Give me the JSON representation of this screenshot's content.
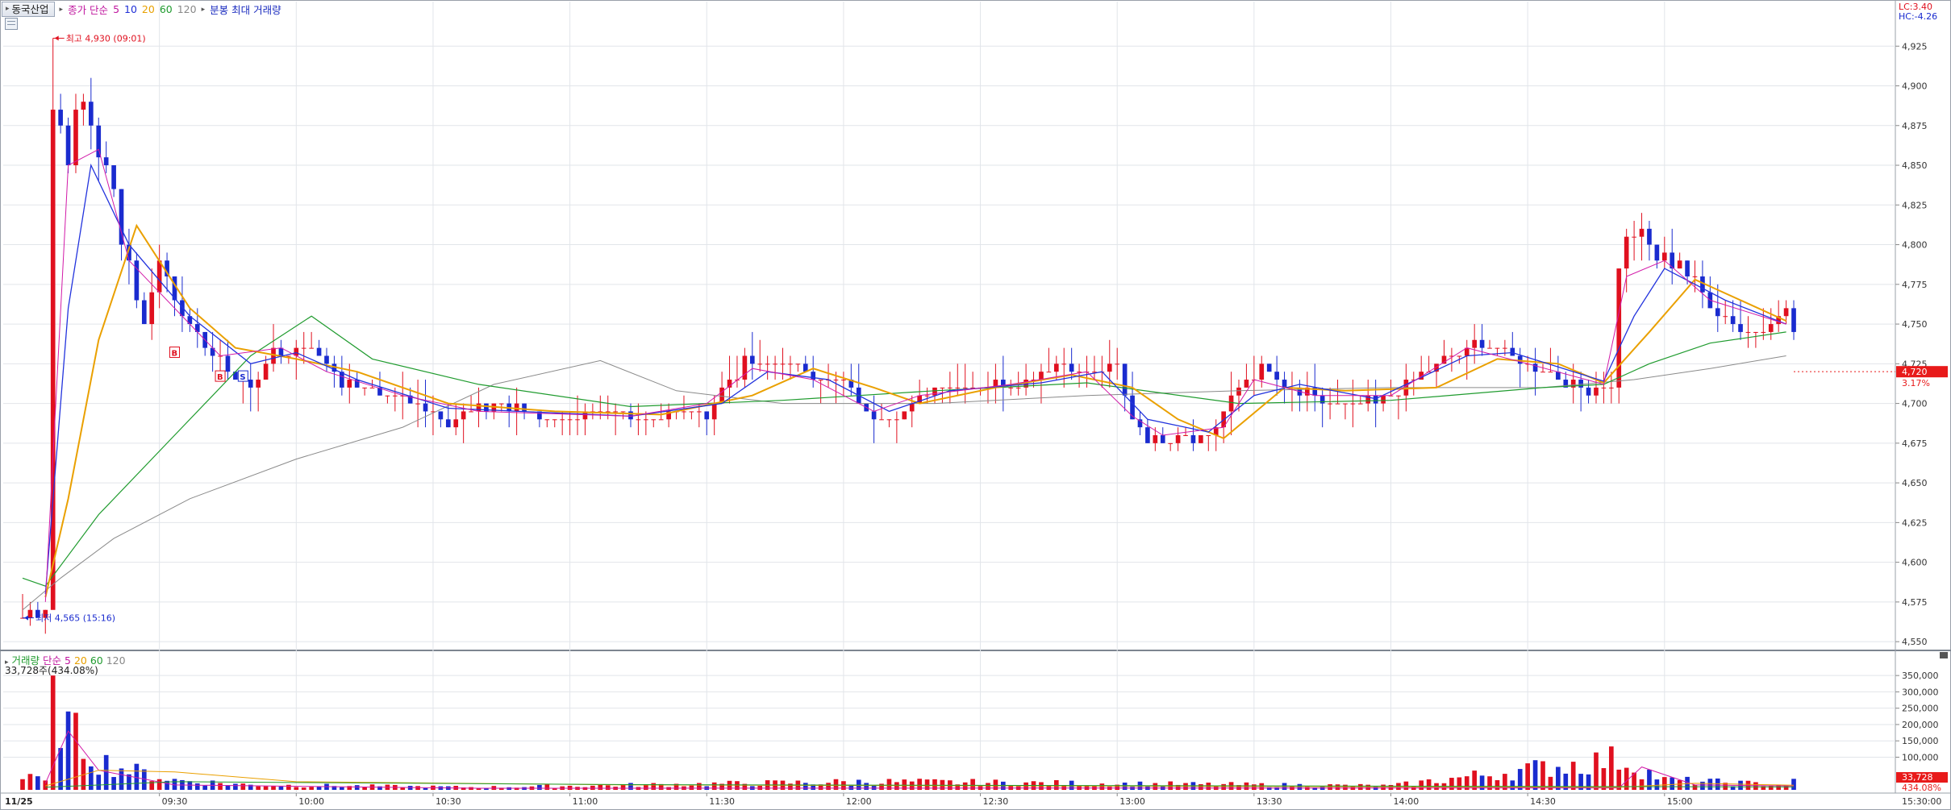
{
  "header": {
    "stock_name": "동국산업",
    "legend_label": "종가 단순",
    "ma_periods": [
      "5",
      "10",
      "20",
      "60",
      "120"
    ],
    "extra_label": "분봉 최대 거래량",
    "lc": "LC:3.40",
    "hc": "HC:-4.26"
  },
  "volume_panel": {
    "label": "거래량",
    "ma_label": "단순",
    "ma_periods": [
      "5",
      "20",
      "60",
      "120"
    ],
    "info": "33,728주(434.08%)",
    "current_tag": "33,728",
    "current_pct": "434.08%"
  },
  "colors": {
    "up": "#e0101f",
    "down": "#1a2bcf",
    "ma5": "#d21aa8",
    "ma10": "#2233dd",
    "ma20": "#eaa000",
    "ma60": "#1f9b2e",
    "ma120": "#8a8a8a",
    "price_tag": "#e81a1a"
  },
  "chart_data": {
    "type": "candlestick",
    "date_label": "11/25",
    "x_ticks": [
      "09:30",
      "10:00",
      "10:30",
      "11:00",
      "11:30",
      "12:00",
      "12:30",
      "13:00",
      "13:30",
      "14:00",
      "14:30",
      "15:00"
    ],
    "x_end_label": "15:30:00",
    "y_ticks": [
      4550,
      4575,
      4600,
      4625,
      4650,
      4675,
      4700,
      4725,
      4750,
      4775,
      4800,
      4825,
      4850,
      4875,
      4900,
      4925
    ],
    "y_tick_labels": [
      "4,550",
      "4,575",
      "4,600",
      "4,625",
      "4,650",
      "4,675",
      "4,700",
      "4,725",
      "4,750",
      "4,775",
      "4,800",
      "4,825",
      "4,850",
      "4,875",
      "4,900",
      "4,925"
    ],
    "ylim": [
      4545,
      4950
    ],
    "high_annotation": "최고 4,930 (09:01)",
    "high_value": 4930,
    "low_annotation": "최저 4,565 (15:16)",
    "low_value": 4565,
    "current_price": 4720,
    "current_price_label": "4,720",
    "current_change_label": "3.17%",
    "volume_ticks": [
      100000,
      150000,
      200000,
      250000,
      300000,
      350000
    ],
    "volume_tick_labels": [
      "100,000",
      "150,000",
      "200,000",
      "250,000",
      "300,000",
      "350,000"
    ],
    "volume_ylim": [
      0,
      380000
    ],
    "signals": [
      "B",
      "B",
      "S"
    ],
    "ohlc_anchors": [
      {
        "t": 0,
        "c": 4565
      },
      {
        "t": 3,
        "c": 4575
      },
      {
        "t": 4,
        "c": 4885
      },
      {
        "t": 6,
        "c": 4860
      },
      {
        "t": 8,
        "c": 4890
      },
      {
        "t": 12,
        "c": 4830
      },
      {
        "t": 14,
        "c": 4790
      },
      {
        "t": 16,
        "c": 4750
      },
      {
        "t": 18,
        "c": 4790
      },
      {
        "t": 22,
        "c": 4745
      },
      {
        "t": 26,
        "c": 4725
      },
      {
        "t": 30,
        "c": 4710
      },
      {
        "t": 33,
        "c": 4732
      },
      {
        "t": 38,
        "c": 4735
      },
      {
        "t": 42,
        "c": 4715
      },
      {
        "t": 48,
        "c": 4705
      },
      {
        "t": 52,
        "c": 4700
      },
      {
        "t": 56,
        "c": 4690
      },
      {
        "t": 62,
        "c": 4700
      },
      {
        "t": 70,
        "c": 4690
      },
      {
        "t": 80,
        "c": 4692
      },
      {
        "t": 90,
        "c": 4695
      },
      {
        "t": 95,
        "c": 4725
      },
      {
        "t": 100,
        "c": 4725
      },
      {
        "t": 108,
        "c": 4712
      },
      {
        "t": 112,
        "c": 4690
      },
      {
        "t": 116,
        "c": 4695
      },
      {
        "t": 120,
        "c": 4710
      },
      {
        "t": 126,
        "c": 4712
      },
      {
        "t": 132,
        "c": 4712
      },
      {
        "t": 136,
        "c": 4725
      },
      {
        "t": 140,
        "c": 4718
      },
      {
        "t": 144,
        "c": 4722
      },
      {
        "t": 146,
        "c": 4690
      },
      {
        "t": 148,
        "c": 4680
      },
      {
        "t": 156,
        "c": 4680
      },
      {
        "t": 160,
        "c": 4710
      },
      {
        "t": 163,
        "c": 4722
      },
      {
        "t": 166,
        "c": 4710
      },
      {
        "t": 172,
        "c": 4700
      },
      {
        "t": 178,
        "c": 4700
      },
      {
        "t": 186,
        "c": 4725
      },
      {
        "t": 192,
        "c": 4740
      },
      {
        "t": 198,
        "c": 4725
      },
      {
        "t": 204,
        "c": 4710
      },
      {
        "t": 209,
        "c": 4710
      },
      {
        "t": 210,
        "c": 4790
      },
      {
        "t": 212,
        "c": 4810
      },
      {
        "t": 215,
        "c": 4790
      },
      {
        "t": 218,
        "c": 4790
      },
      {
        "t": 222,
        "c": 4762
      },
      {
        "t": 226,
        "c": 4745
      },
      {
        "t": 230,
        "c": 4752
      },
      {
        "t": 232,
        "c": 4758
      },
      {
        "t": 233,
        "c": 4745
      }
    ],
    "ma_anchors": {
      "ma5": [
        [
          3,
          4575
        ],
        [
          6,
          4850
        ],
        [
          10,
          4860
        ],
        [
          14,
          4790
        ],
        [
          20,
          4760
        ],
        [
          26,
          4730
        ],
        [
          34,
          4735
        ],
        [
          40,
          4720
        ],
        [
          50,
          4705
        ],
        [
          60,
          4695
        ],
        [
          80,
          4692
        ],
        [
          90,
          4700
        ],
        [
          96,
          4722
        ],
        [
          104,
          4715
        ],
        [
          112,
          4695
        ],
        [
          118,
          4705
        ],
        [
          130,
          4712
        ],
        [
          140,
          4720
        ],
        [
          146,
          4692
        ],
        [
          150,
          4680
        ],
        [
          158,
          4685
        ],
        [
          162,
          4715
        ],
        [
          170,
          4705
        ],
        [
          180,
          4705
        ],
        [
          190,
          4735
        ],
        [
          198,
          4725
        ],
        [
          208,
          4712
        ],
        [
          211,
          4780
        ],
        [
          216,
          4790
        ],
        [
          222,
          4765
        ],
        [
          232,
          4750
        ]
      ],
      "ma10": [
        [
          3,
          4580
        ],
        [
          6,
          4760
        ],
        [
          9,
          4850
        ],
        [
          14,
          4800
        ],
        [
          22,
          4755
        ],
        [
          30,
          4725
        ],
        [
          36,
          4732
        ],
        [
          44,
          4715
        ],
        [
          56,
          4697
        ],
        [
          80,
          4692
        ],
        [
          92,
          4700
        ],
        [
          98,
          4720
        ],
        [
          106,
          4715
        ],
        [
          114,
          4695
        ],
        [
          122,
          4708
        ],
        [
          134,
          4713
        ],
        [
          142,
          4720
        ],
        [
          148,
          4690
        ],
        [
          156,
          4682
        ],
        [
          162,
          4705
        ],
        [
          168,
          4712
        ],
        [
          178,
          4703
        ],
        [
          190,
          4730
        ],
        [
          196,
          4732
        ],
        [
          208,
          4714
        ],
        [
          212,
          4755
        ],
        [
          216,
          4785
        ],
        [
          224,
          4765
        ],
        [
          232,
          4750
        ]
      ],
      "ma20": [
        [
          3,
          4578
        ],
        [
          6,
          4640
        ],
        [
          10,
          4740
        ],
        [
          15,
          4812
        ],
        [
          22,
          4760
        ],
        [
          28,
          4735
        ],
        [
          36,
          4728
        ],
        [
          44,
          4720
        ],
        [
          56,
          4700
        ],
        [
          70,
          4695
        ],
        [
          84,
          4693
        ],
        [
          96,
          4705
        ],
        [
          104,
          4722
        ],
        [
          112,
          4710
        ],
        [
          118,
          4700
        ],
        [
          128,
          4710
        ],
        [
          138,
          4718
        ],
        [
          146,
          4710
        ],
        [
          152,
          4690
        ],
        [
          158,
          4678
        ],
        [
          166,
          4710
        ],
        [
          174,
          4708
        ],
        [
          186,
          4710
        ],
        [
          194,
          4728
        ],
        [
          202,
          4725
        ],
        [
          208,
          4713
        ],
        [
          214,
          4745
        ],
        [
          220,
          4778
        ],
        [
          226,
          4765
        ],
        [
          232,
          4752
        ]
      ],
      "ma60": [
        [
          0,
          4590
        ],
        [
          3,
          4585
        ],
        [
          10,
          4630
        ],
        [
          20,
          4680
        ],
        [
          30,
          4730
        ],
        [
          38,
          4755
        ],
        [
          46,
          4728
        ],
        [
          60,
          4712
        ],
        [
          80,
          4698
        ],
        [
          100,
          4702
        ],
        [
          120,
          4708
        ],
        [
          140,
          4713
        ],
        [
          160,
          4700
        ],
        [
          180,
          4702
        ],
        [
          200,
          4710
        ],
        [
          208,
          4712
        ],
        [
          214,
          4725
        ],
        [
          222,
          4738
        ],
        [
          232,
          4745
        ]
      ],
      "ma120": [
        [
          0,
          4570
        ],
        [
          5,
          4590
        ],
        [
          12,
          4615
        ],
        [
          22,
          4640
        ],
        [
          36,
          4665
        ],
        [
          50,
          4685
        ],
        [
          62,
          4712
        ],
        [
          76,
          4727
        ],
        [
          86,
          4708
        ],
        [
          100,
          4700
        ],
        [
          120,
          4700
        ],
        [
          140,
          4705
        ],
        [
          160,
          4708
        ],
        [
          180,
          4710
        ],
        [
          200,
          4710
        ],
        [
          212,
          4715
        ],
        [
          222,
          4722
        ],
        [
          232,
          4730
        ]
      ]
    },
    "volume_anchors": [
      [
        3,
        20000
      ],
      [
        4,
        350000
      ],
      [
        5,
        240000
      ],
      [
        6,
        180000
      ],
      [
        8,
        140000
      ],
      [
        10,
        90000
      ],
      [
        14,
        60000
      ],
      [
        20,
        30000
      ],
      [
        30,
        15000
      ],
      [
        60,
        8000
      ],
      [
        111,
        25000
      ],
      [
        180,
        12000
      ],
      [
        210,
        95000
      ],
      [
        212,
        75000
      ],
      [
        216,
        30000
      ],
      [
        232,
        15000
      ],
      [
        233,
        33728
      ]
    ]
  }
}
